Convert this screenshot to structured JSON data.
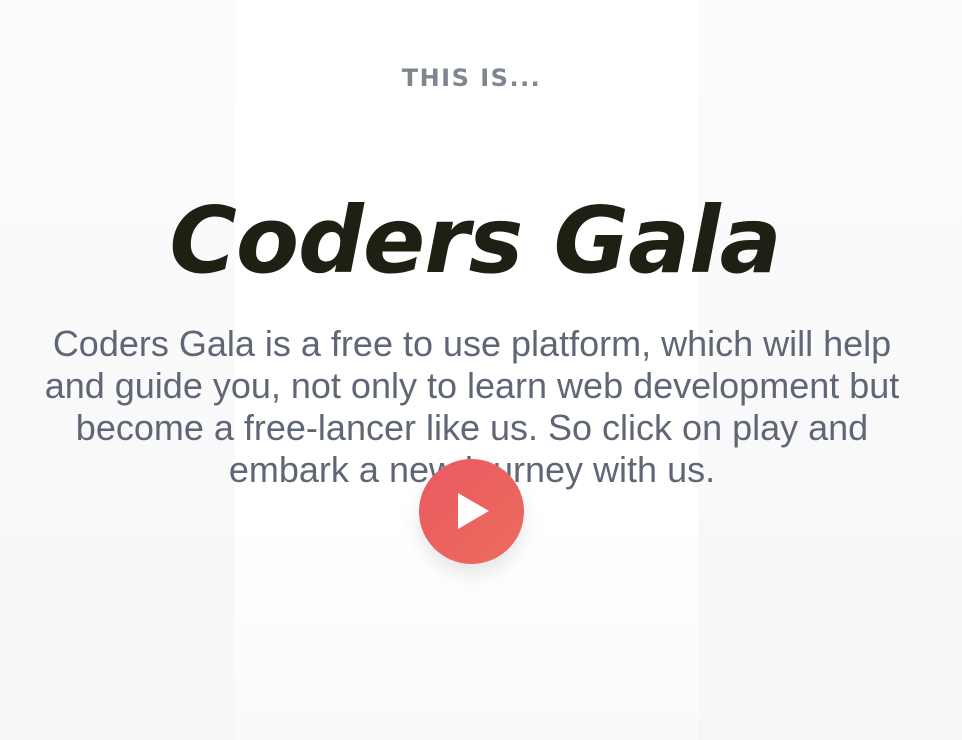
{
  "hero": {
    "eyebrow": "THIS IS...",
    "title": "Coders Gala",
    "description": "Coders Gala is a free to use platform, which will help and guide you, not only to learn web development but become a free-lancer like us. So click on play and embark a new journey with us.",
    "play_icon": "play-icon",
    "accent_color": "#ec5f60"
  }
}
